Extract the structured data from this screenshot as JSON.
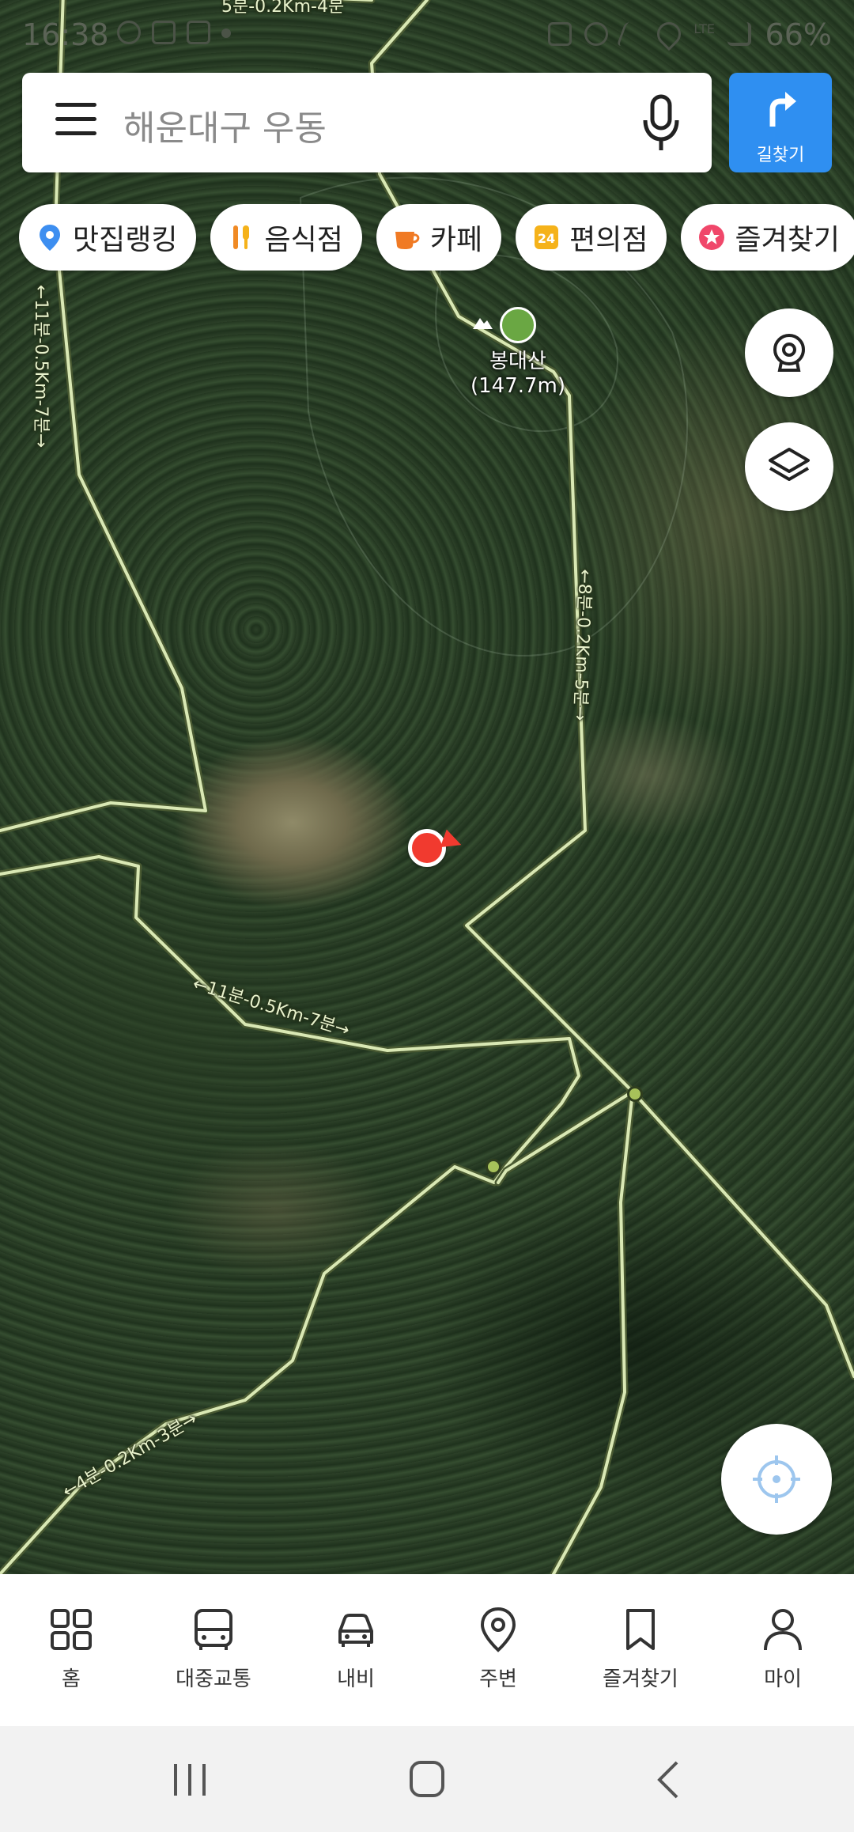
{
  "status_bar": {
    "time": "16:38",
    "battery": "66%",
    "network": "LTE"
  },
  "search": {
    "query": "해운대구 우동",
    "route_button_label": "길찾기"
  },
  "chips": [
    {
      "label": "맛집랭킹",
      "icon": "location-pin-icon",
      "color": "#3d8ef0"
    },
    {
      "label": "음식점",
      "icon": "utensils-icon",
      "color": "#f08a24"
    },
    {
      "label": "카페",
      "icon": "coffee-cup-icon",
      "color": "#f07a24"
    },
    {
      "label": "편의점",
      "icon": "24-store-icon",
      "color": "#f5b21a"
    },
    {
      "label": "즐겨찾기",
      "icon": "star-icon",
      "color": "#f0476a"
    }
  ],
  "map": {
    "poi": {
      "name": "봉대산",
      "elevation": "(147.7m)"
    },
    "trail_labels": [
      "5분-0.2Km-4분",
      "←11분-0.5Km-7분→",
      "←8분-0.2Km-5분→",
      "←11분-0.5Km-7분→",
      "←4분-0.2Km-3분→"
    ],
    "colors": {
      "trail": "#d9e8b4",
      "location": "#f13a2f",
      "accent": "#2f8ff1"
    }
  },
  "bottom_nav": [
    {
      "label": "홈",
      "icon": "grid-icon"
    },
    {
      "label": "대중교통",
      "icon": "bus-icon"
    },
    {
      "label": "내비",
      "icon": "car-icon"
    },
    {
      "label": "주변",
      "icon": "map-pin-icon"
    },
    {
      "label": "즐겨찾기",
      "icon": "bookmark-icon"
    },
    {
      "label": "마이",
      "icon": "person-icon"
    }
  ]
}
